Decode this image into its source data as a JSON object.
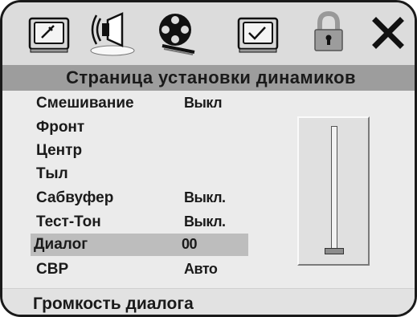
{
  "tabs": [
    {
      "icon": "tv-wrench-icon",
      "active": false
    },
    {
      "icon": "speaker-icon",
      "active": true
    },
    {
      "icon": "film-reel-icon",
      "active": false
    },
    {
      "icon": "tv-checkmark-icon",
      "active": false
    },
    {
      "icon": "padlock-icon",
      "active": false
    },
    {
      "icon": "close-icon",
      "active": false
    }
  ],
  "page_title": "Страница установки динамиков",
  "menu": {
    "items": [
      {
        "label": "Смешивание",
        "value": "Выкл"
      },
      {
        "label": "Фронт",
        "value": ""
      },
      {
        "label": "Центр",
        "value": ""
      },
      {
        "label": "Тыл",
        "value": ""
      },
      {
        "label": "Сабвуфер",
        "value": "Выкл."
      },
      {
        "label": "Тест-Тон",
        "value": "Выкл."
      },
      {
        "label": "Диалог",
        "value": "00",
        "selected": true
      },
      {
        "label": "СВР",
        "value": "Авто"
      }
    ]
  },
  "slider": {
    "level_fraction": 0.0
  },
  "status": {
    "text": "Громкость диалога"
  },
  "colors": {
    "frame_border": "#1a1a1a",
    "title_bar": "#9d9d9d",
    "menu_background": "#ebebeb",
    "selected_row": "#bdbdbd",
    "text": "#1a1a1a"
  }
}
